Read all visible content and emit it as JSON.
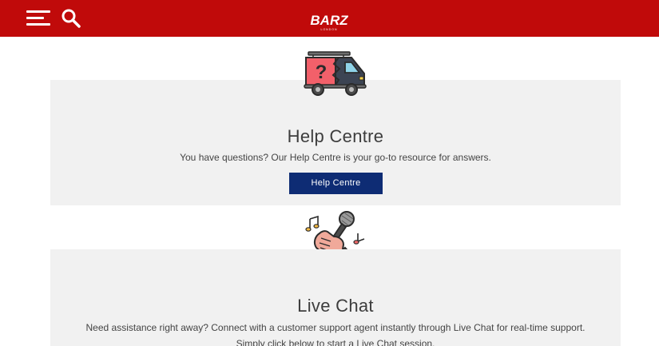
{
  "header": {
    "logo_text": "BARZ",
    "logo_subtext": "LONDON",
    "menu_icon": "hamburger-menu-icon",
    "search_icon": "search-icon",
    "background_color": "#c00a0a"
  },
  "help_centre": {
    "illustration": "question-mark-van-illustration",
    "title": "Help Centre",
    "description": "You have questions? Our Help Centre is your go-to resource for answers.",
    "button_label": "Help Centre",
    "button_color": "#0e2c74"
  },
  "live_chat": {
    "illustration": "hand-holding-microphone-illustration",
    "title": "Live Chat",
    "description": "Need assistance right away? Connect with a customer support agent instantly through Live Chat for real-time support. Simply click below to start a Live Chat session."
  }
}
